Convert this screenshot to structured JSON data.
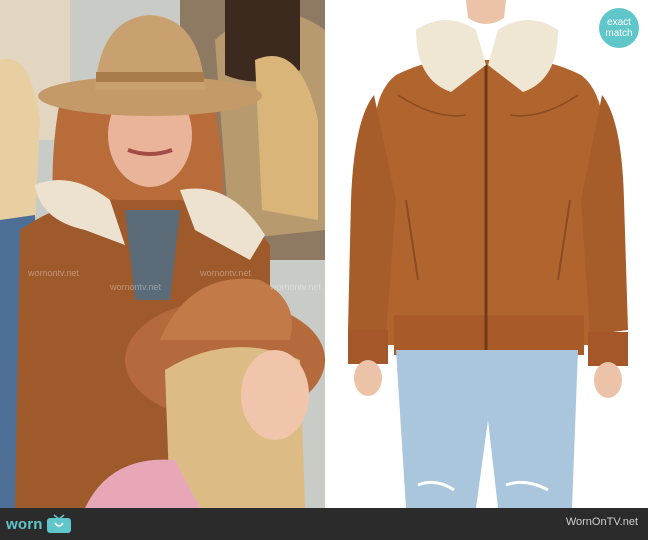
{
  "badge": {
    "line1": "exact",
    "line2": "match"
  },
  "footer": {
    "logo_text": "worn",
    "site": "WornOnTV.net"
  },
  "watermarks": [
    "wornontv.net",
    "wornontv.net",
    "wornontv.net",
    "wornontv.net"
  ],
  "colors": {
    "accent": "#5fc6c9",
    "jacket": "#b0652f",
    "collar": "#efe6d4",
    "jeans": "#a9c6dc",
    "footer_bg": "#2b2b2b"
  }
}
